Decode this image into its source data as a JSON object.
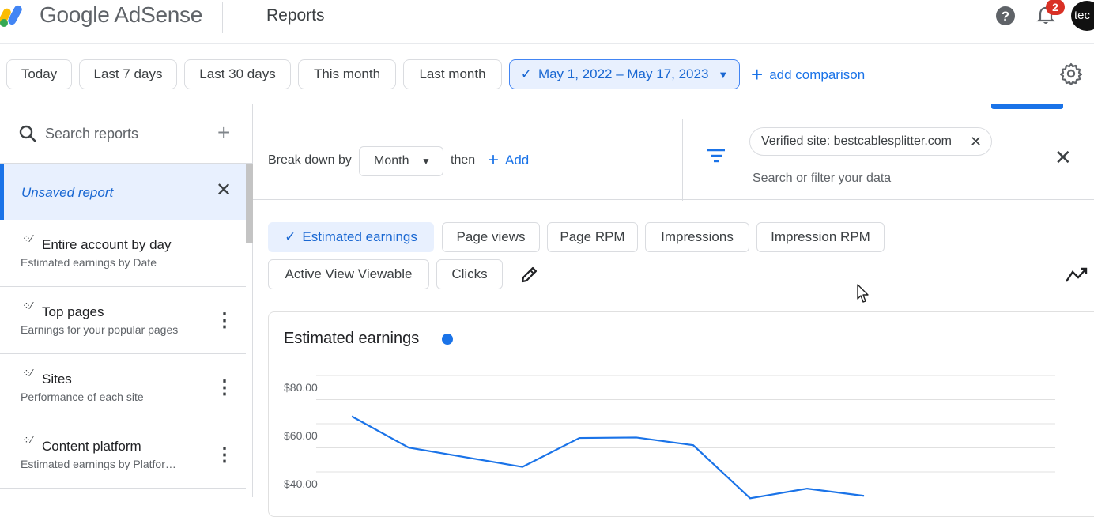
{
  "header": {
    "brand": "Google AdSense",
    "page_title": "Reports",
    "notification_count": "2",
    "avatar_text": "tec"
  },
  "date_range": {
    "chips": [
      "Today",
      "Last 7 days",
      "Last 30 days",
      "This month",
      "Last month"
    ],
    "selected": "May 1, 2022 – May 17, 2023",
    "add_comparison": "add comparison"
  },
  "sidebar": {
    "search_placeholder": "Search reports",
    "unsaved": "Unsaved report",
    "reports": [
      {
        "title": "Entire account by day",
        "subtitle": "Estimated earnings by Date",
        "menu": false
      },
      {
        "title": "Top pages",
        "subtitle": "Earnings for your popular pages",
        "menu": true
      },
      {
        "title": "Sites",
        "subtitle": "Performance of each site",
        "menu": true
      },
      {
        "title": "Content platform",
        "subtitle": "Estimated earnings by Platfor…",
        "menu": true
      }
    ]
  },
  "breakdown": {
    "label": "Break down by",
    "value": "Month",
    "then": "then",
    "add": "Add"
  },
  "filter": {
    "chip": "Verified site: bestcablesplitter.com",
    "search_placeholder": "Search or filter your data"
  },
  "metrics": {
    "selected": "Estimated earnings",
    "others": [
      "Page views",
      "Page RPM",
      "Impressions",
      "Impression RPM",
      "Active View Viewable",
      "Clicks"
    ]
  },
  "colors": {
    "accent": "#1a73e8",
    "selected_bg": "#e8f0fe",
    "badge": "#d93025"
  },
  "chart_data": {
    "type": "line",
    "title": "Estimated earnings",
    "y_ticks": [
      "$80.00",
      "$60.00",
      "$40.00"
    ],
    "ylim": [
      40,
      80
    ],
    "grid": true,
    "series": [
      {
        "name": "Estimated earnings",
        "values": [
          68,
          55,
          51,
          47,
          59,
          59.2,
          56,
          34,
          38,
          35
        ]
      }
    ]
  }
}
